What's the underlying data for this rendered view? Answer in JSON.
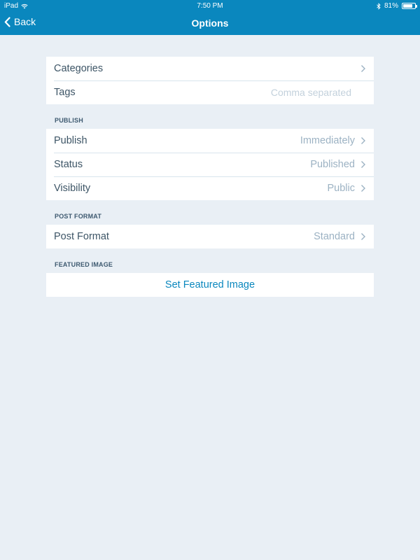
{
  "status_bar": {
    "device": "iPad",
    "time": "7:50 PM",
    "battery": "81%",
    "battery_level": 0.81
  },
  "nav": {
    "back_label": "Back",
    "title": "Options"
  },
  "general": {
    "categories_label": "Categories",
    "tags_label": "Tags",
    "tags_placeholder": "Comma separated"
  },
  "publish_section": {
    "header": "PUBLISH",
    "rows": [
      {
        "label": "Publish",
        "value": "Immediately"
      },
      {
        "label": "Status",
        "value": "Published"
      },
      {
        "label": "Visibility",
        "value": "Public"
      }
    ]
  },
  "post_format_section": {
    "header": "POST FORMAT",
    "row": {
      "label": "Post Format",
      "value": "Standard"
    }
  },
  "featured_image_section": {
    "header": "FEATURED IMAGE",
    "action_label": "Set Featured Image"
  },
  "colors": {
    "nav_bar": "#0a87be",
    "background": "#e9eff5",
    "accent": "#0a87be"
  }
}
